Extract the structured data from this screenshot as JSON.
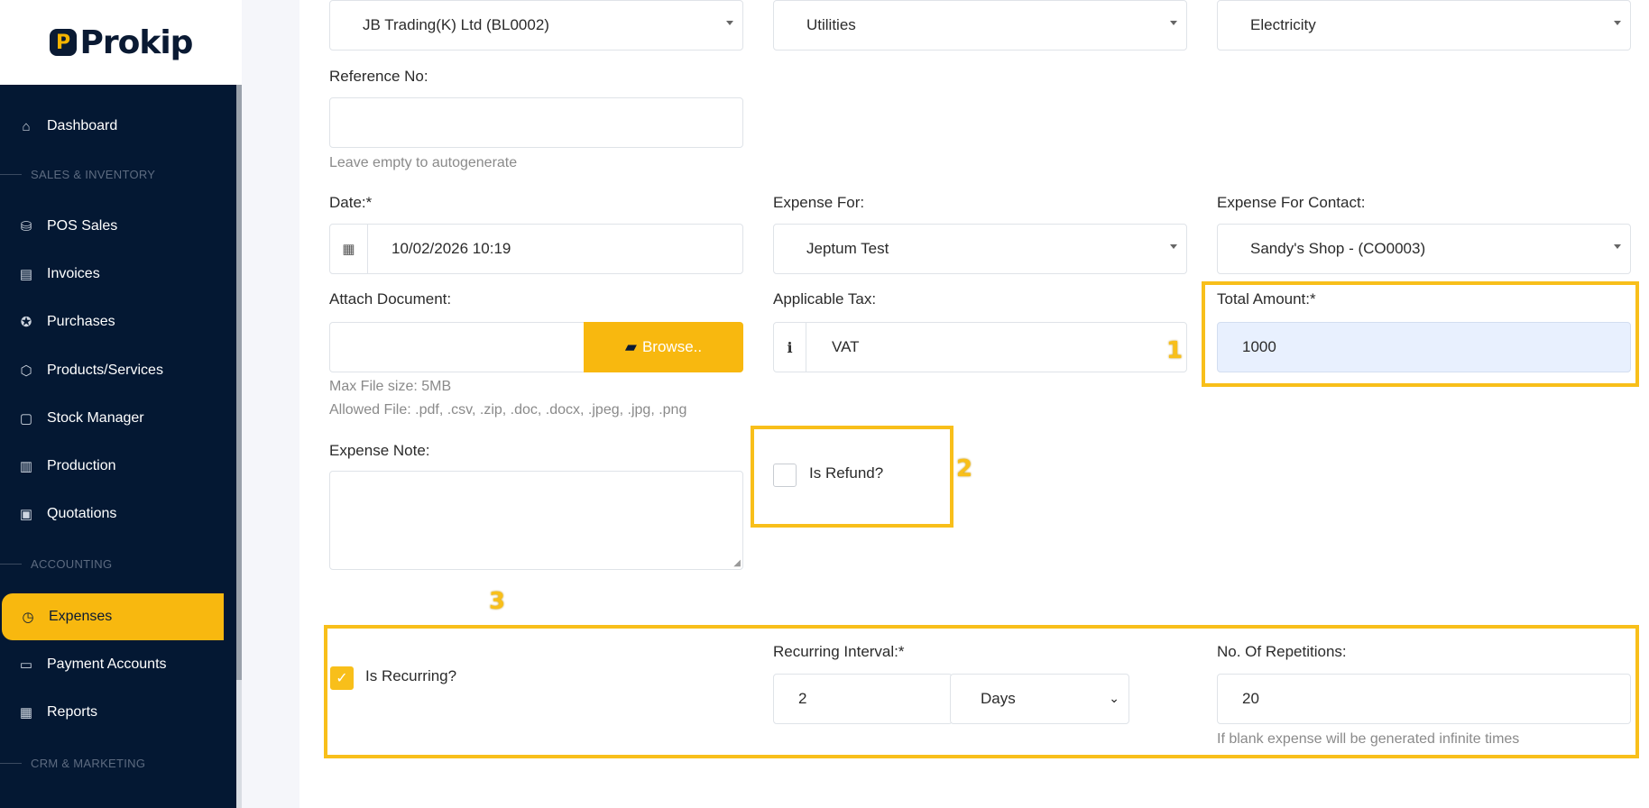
{
  "sidebar": {
    "logo_text": "Prokip",
    "logo_mark": "P",
    "items": [
      {
        "label": "Dashboard",
        "icon": "home-icon",
        "glyph": "⌂"
      },
      {
        "label": "POS Sales",
        "icon": "shopping-bag-icon",
        "glyph": "⛁"
      },
      {
        "label": "Invoices",
        "icon": "invoice-icon",
        "glyph": "▤"
      },
      {
        "label": "Purchases",
        "icon": "purchase-icon",
        "glyph": "✪"
      },
      {
        "label": "Products/Services",
        "icon": "box-icon",
        "glyph": "⬡"
      },
      {
        "label": "Stock Manager",
        "icon": "clipboard-icon",
        "glyph": "▢"
      },
      {
        "label": "Production",
        "icon": "factory-icon",
        "glyph": "▥"
      },
      {
        "label": "Quotations",
        "icon": "quote-icon",
        "glyph": "▣"
      },
      {
        "label": "Expenses",
        "icon": "clock-icon",
        "glyph": "◷"
      },
      {
        "label": "Payment Accounts",
        "icon": "wallet-icon",
        "glyph": "▭"
      },
      {
        "label": "Reports",
        "icon": "presentation-icon",
        "glyph": "▦"
      }
    ],
    "sections": [
      "SALES & INVENTORY",
      "ACCOUNTING",
      "CRM & MARKETING"
    ]
  },
  "form": {
    "business_location": "JB Trading(K) Ltd (BL0002)",
    "category": "Utilities",
    "sub_category": "Electricity",
    "reference_label": "Reference No:",
    "reference_value": "",
    "reference_help": "Leave empty to autogenerate",
    "date_label": "Date:*",
    "date_value": "10/02/2026 10:19",
    "expense_for_label": "Expense For:",
    "expense_for_value": "Jeptum Test",
    "expense_contact_label": "Expense For Contact:",
    "expense_contact_value": "Sandy's Shop - (CO0003)",
    "attach_label": "Attach Document:",
    "browse_label": "Browse..",
    "max_file": "Max File size: 5MB",
    "allowed_file": "Allowed File: .pdf, .csv, .zip, .doc, .docx, .jpeg, .jpg, .png",
    "tax_label": "Applicable Tax:",
    "tax_value": "VAT",
    "total_label": "Total Amount:*",
    "total_value": "1000",
    "note_label": "Expense Note:",
    "refund_label": "Is Refund?",
    "refund_checked": false,
    "recurring_label": "Is Recurring?",
    "recurring_checked": true,
    "interval_label": "Recurring Interval:*",
    "interval_value": "2",
    "interval_unit": "Days",
    "repetitions_label": "No. Of Repetitions:",
    "repetitions_value": "20",
    "repetitions_help": "If blank expense will be generated infinite times"
  },
  "highlights": {
    "h1": "1",
    "h2": "2",
    "h3": "3"
  },
  "colors": {
    "accent": "#f8b80f",
    "sidebar_bg": "#041833",
    "highlight": "#f8bf1a",
    "total_bg": "#e8f0fe"
  }
}
